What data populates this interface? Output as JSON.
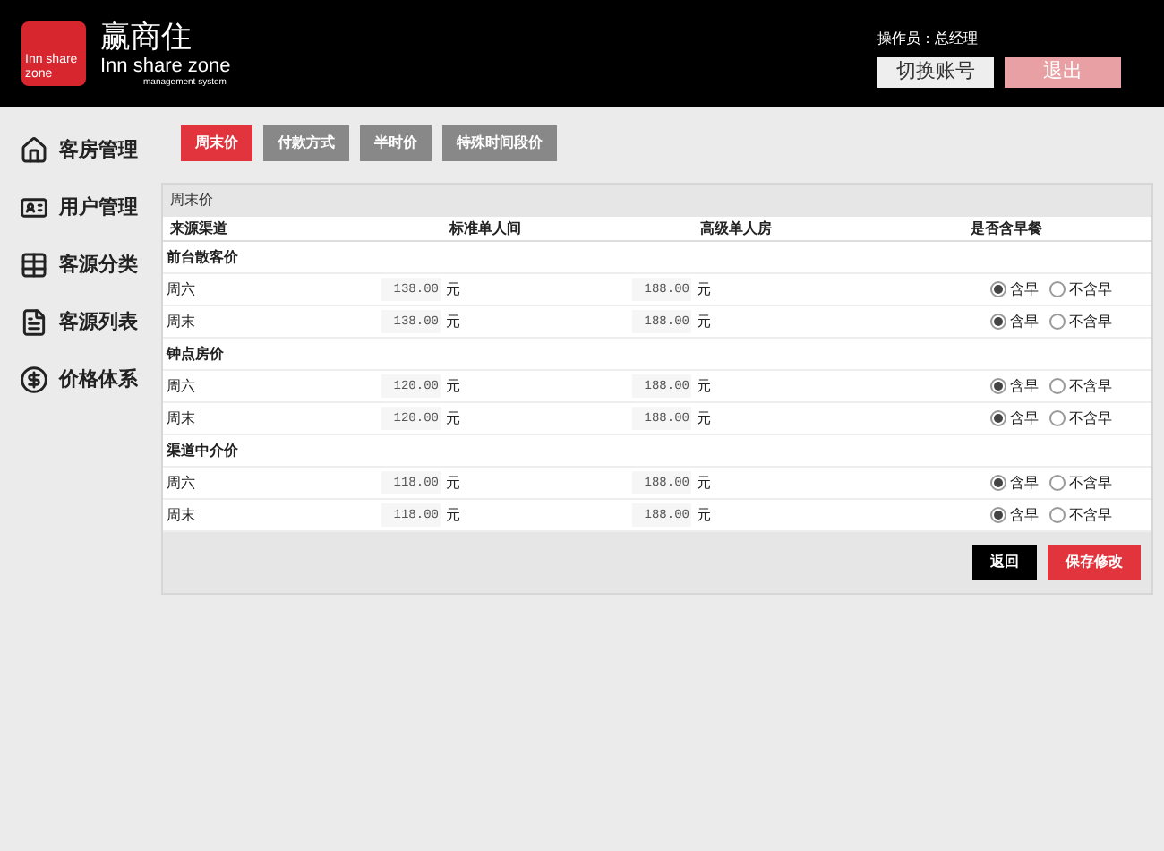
{
  "header": {
    "logo_mark": "Inn share zone",
    "brand": "赢商住",
    "brand_en": "Inn share zone",
    "tagline": "management system",
    "operator": "操作员：总经理",
    "buttons": [
      {
        "label": "切换账号",
        "kind": "switch"
      },
      {
        "label": "退出",
        "kind": "logout"
      }
    ]
  },
  "sidebar": {
    "items": [
      {
        "label": "客房管理"
      },
      {
        "label": "用户管理"
      },
      {
        "label": "客源分类"
      },
      {
        "label": "客源列表"
      },
      {
        "label": "价格体系"
      }
    ]
  },
  "tabs": [
    {
      "label": "周末价",
      "selected": true
    },
    {
      "label": "付款方式",
      "selected": false
    },
    {
      "label": "半时价",
      "selected": false
    },
    {
      "label": "特殊时间段价",
      "selected": false
    }
  ],
  "panel": {
    "title": "周末价",
    "columns": [
      "来源渠道",
      "标准单人间",
      "高级单人房",
      "是否含早餐"
    ],
    "groups": [
      {
        "name": "前台散客价",
        "rows": [
          {
            "day": "周六",
            "standard": "138.00",
            "standard_unit": "元",
            "deluxe": "188.00",
            "deluxe_unit": "元",
            "options": [
              {
                "label": "含早",
                "selected": true
              },
              {
                "label": "不含早",
                "selected": false
              }
            ]
          },
          {
            "day": "周末",
            "standard": "138.00",
            "standard_unit": "元",
            "deluxe": "188.00",
            "deluxe_unit": "元",
            "options": [
              {
                "label": "含早",
                "selected": true
              },
              {
                "label": "不含早",
                "selected": false
              }
            ]
          }
        ]
      },
      {
        "name": "钟点房价",
        "rows": [
          {
            "day": "周六",
            "standard": "120.00",
            "standard_unit": "元",
            "deluxe": "188.00",
            "deluxe_unit": "元",
            "options": [
              {
                "label": "含早",
                "selected": true
              },
              {
                "label": "不含早",
                "selected": false
              }
            ]
          },
          {
            "day": "周末",
            "standard": "120.00",
            "standard_unit": "元",
            "deluxe": "188.00",
            "deluxe_unit": "元",
            "options": [
              {
                "label": "含早",
                "selected": true
              },
              {
                "label": "不含早",
                "selected": false
              }
            ]
          }
        ]
      },
      {
        "name": "渠道中介价",
        "rows": [
          {
            "day": "周六",
            "standard": "118.00",
            "standard_unit": "元",
            "deluxe": "188.00",
            "deluxe_unit": "元",
            "options": [
              {
                "label": "含早",
                "selected": true
              },
              {
                "label": "不含早",
                "selected": false
              }
            ]
          },
          {
            "day": "周末",
            "standard": "118.00",
            "standard_unit": "元",
            "deluxe": "188.00",
            "deluxe_unit": "元",
            "options": [
              {
                "label": "含早",
                "selected": true
              },
              {
                "label": "不含早",
                "selected": false
              }
            ]
          }
        ]
      }
    ],
    "buttons": [
      {
        "label": "返回",
        "kind": "back"
      },
      {
        "label": "保存修改",
        "kind": "save"
      }
    ]
  }
}
